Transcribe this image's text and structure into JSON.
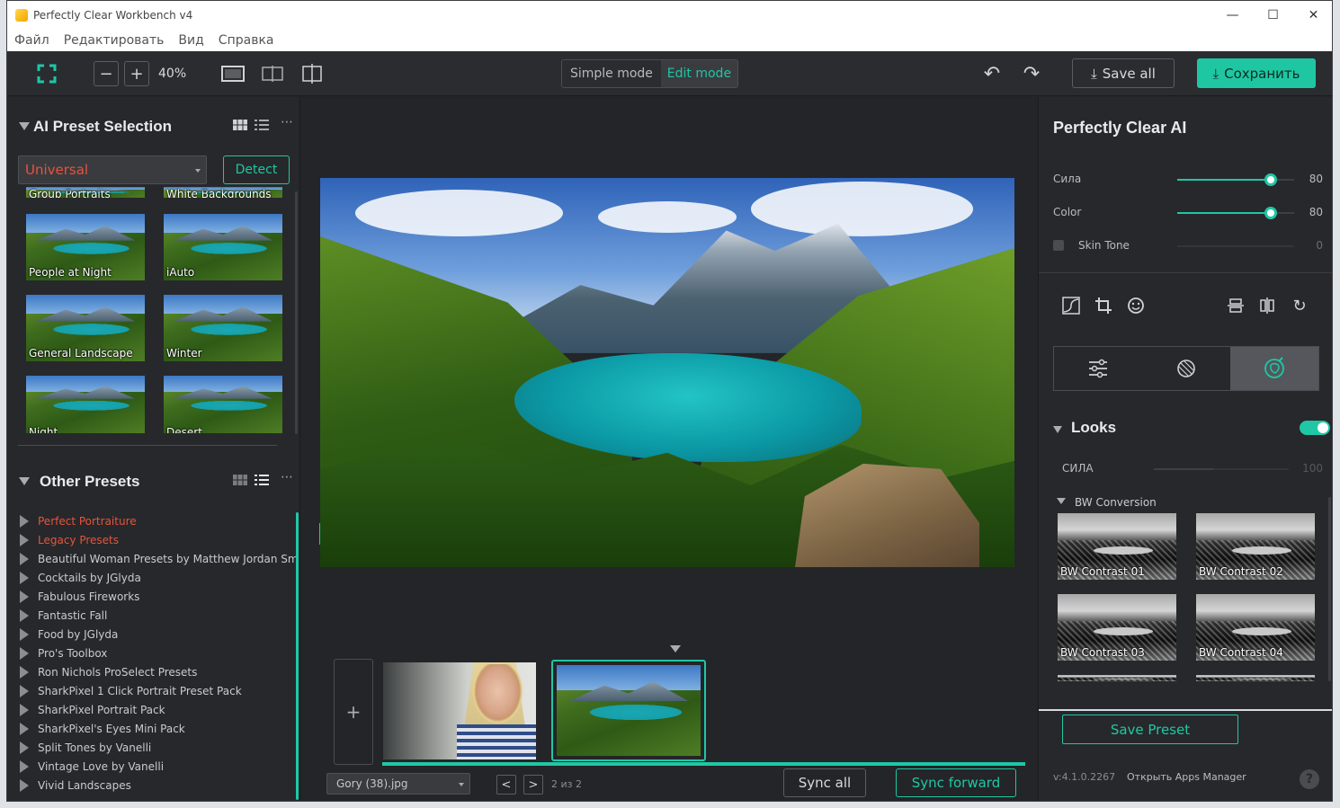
{
  "window": {
    "title": "Perfectly Clear Workbench v4",
    "minimize": "—",
    "maximize": "☐",
    "close": "✕"
  },
  "menu": [
    "Файл",
    "Редактировать",
    "Вид",
    "Справка"
  ],
  "toolbar": {
    "zoom_out": "−",
    "zoom_in": "+",
    "zoom_level": "40%",
    "simple_mode": "Simple mode",
    "edit_mode": "Edit mode",
    "save_all": "Save all",
    "save": "Сохранить"
  },
  "ai_presets": {
    "title": "AI Preset Selection",
    "selected": "Universal",
    "detect": "Detect",
    "partial_top": [
      "Group Portraits",
      "White Backgrounds"
    ],
    "thumbnails": [
      "People at Night",
      "iAuto",
      "General Landscape",
      "Winter",
      "Night",
      "Desert"
    ]
  },
  "other_presets": {
    "title": "Other Presets",
    "items": [
      {
        "label": "Perfect Portraiture",
        "highlight": true
      },
      {
        "label": "Legacy Presets",
        "highlight": true
      },
      {
        "label": "Beautiful Woman Presets by Matthew Jordan Sm...",
        "highlight": false
      },
      {
        "label": "Cocktails by JGlyda",
        "highlight": false
      },
      {
        "label": "Fabulous Fireworks",
        "highlight": false
      },
      {
        "label": "Fantastic Fall",
        "highlight": false
      },
      {
        "label": "Food by JGlyda",
        "highlight": false
      },
      {
        "label": "Pro's Toolbox",
        "highlight": false
      },
      {
        "label": "Ron Nichols ProSelect Presets",
        "highlight": false
      },
      {
        "label": "SharkPixel 1 Click Portrait Preset Pack",
        "highlight": false
      },
      {
        "label": "SharkPixel Portrait Pack",
        "highlight": false
      },
      {
        "label": "SharkPixel's Eyes Mini Pack",
        "highlight": false
      },
      {
        "label": "Split Tones by Vanelli",
        "highlight": false
      },
      {
        "label": "Vintage Love by Vanelli",
        "highlight": false
      },
      {
        "label": "Vivid Landscapes",
        "highlight": false
      }
    ]
  },
  "filmstrip": {
    "add": "+",
    "filename": "Gory (38).jpg",
    "prev": "<",
    "next": ">",
    "page": "2 из 2",
    "sync_all": "Sync all",
    "sync_forward": "Sync forward"
  },
  "right": {
    "title": "Perfectly Clear AI",
    "sliders": [
      {
        "label": "Сила",
        "value": "80",
        "level": 0.8
      },
      {
        "label": "Color",
        "value": "80",
        "level": 0.8
      }
    ],
    "skin_tone": {
      "label": "Skin Tone",
      "value": "0"
    },
    "looks": {
      "title": "Looks",
      "strength_label": "СИЛА",
      "strength_value": "100",
      "enabled": true
    },
    "bw": {
      "title": "BW Conversion",
      "thumbnails": [
        "BW Contrast 01",
        "BW Contrast 02",
        "BW Contrast 03",
        "BW Contrast 04"
      ]
    },
    "save_preset": "Save Preset",
    "version": "v:4.1.0.2267",
    "apps_manager": "Открыть Apps Manager",
    "help": "?"
  },
  "colors": {
    "accent": "#1fc7a6",
    "warning": "#e8533a",
    "panel": "#27282b"
  }
}
